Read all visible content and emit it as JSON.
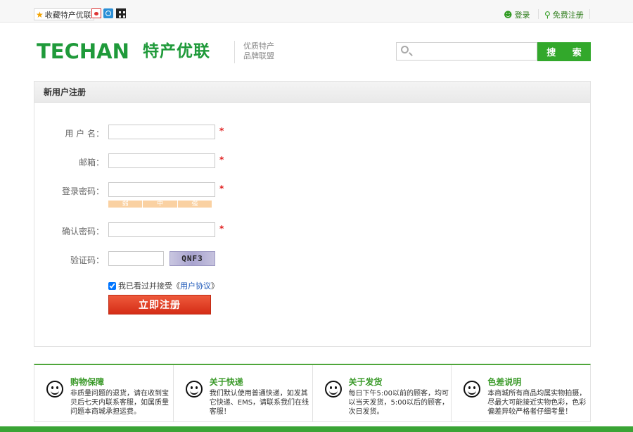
{
  "topbar": {
    "favorite_label": "收藏特产优联",
    "login_label": "登录",
    "register_label": "免费注册"
  },
  "header": {
    "logo_text": "TECHAN",
    "logo_cn": "特产优联",
    "slogan_line1": "优质特产",
    "slogan_line2": "品牌联盟",
    "search": {
      "value": "",
      "placeholder": ""
    },
    "search_button": "搜 索"
  },
  "form": {
    "title": "新用户注册",
    "fields": [
      {
        "label": "用 户 名：",
        "value": "",
        "required_mark": "*"
      },
      {
        "label": "邮箱：",
        "value": "",
        "required_mark": "*"
      },
      {
        "label": "登录密码：",
        "value": "",
        "required_mark": "*"
      },
      {
        "label": "确认密码：",
        "value": "",
        "required_mark": "*"
      },
      {
        "label": "验证码：",
        "value": ""
      }
    ],
    "strength": [
      "弱",
      "中",
      "强"
    ],
    "captcha_text": "QNF3",
    "agree_text": "我已看过并接受《",
    "agree_link": "用户协议",
    "agree_close": "》",
    "agree_checked": true,
    "submit_label": "立即注册"
  },
  "promises": [
    {
      "title": "购物保障",
      "text": "非质量问题的退货，请在收到宝贝后七天内联系客服，如属质量问题本商城承担运费。",
      "icon": "smile-icon"
    },
    {
      "title": "关于快递",
      "text": "我们默认使用普通快递，如发其它快递、EMS，请联系我们在线客服！",
      "icon": "smile-icon"
    },
    {
      "title": "关于发货",
      "text": "每日下午5:00以前的顾客，均可以当天发货，5:00以后的顾客，次日发货。",
      "icon": "smile-icon"
    },
    {
      "title": "色差说明",
      "text": "本商城所有商品均属实物拍摄，尽最大可能接近实物色彩，色彩偏差异较严格者仔细考量！",
      "icon": "smile-icon"
    }
  ],
  "colors": {
    "brand_green": "#1f9a3a",
    "search_button": "#32a82b",
    "submit_red": "#d52d16",
    "required": "#e02020"
  }
}
